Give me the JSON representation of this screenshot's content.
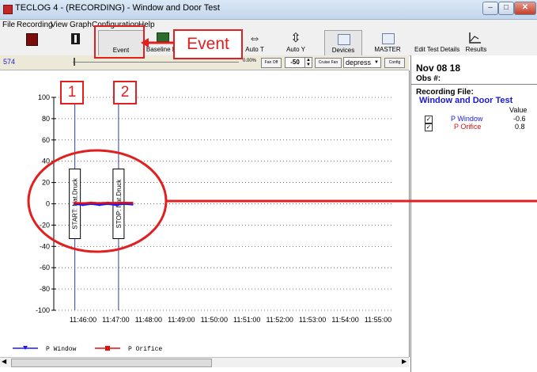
{
  "window": {
    "title": "TECLOG 4 - (RECORDING) - Window and Door Test",
    "minimize": "–",
    "maximize": "□",
    "close": "✕"
  },
  "menu": [
    "File",
    "Recording",
    "View",
    "Graph",
    "Configuration",
    "Help"
  ],
  "toolbar": {
    "buttons": [
      {
        "label": "",
        "icon": "stop-icon"
      },
      {
        "label": "",
        "icon": "pause-icon"
      },
      {
        "label": "Event",
        "icon": "event-icon"
      },
      {
        "label": "Baseline E",
        "icon": "baseline-icon"
      },
      {
        "label": "Auto T",
        "icon": "horizontal-arrows-icon"
      },
      {
        "label": "Auto Y",
        "icon": "vertical-arrows-icon"
      },
      {
        "label": "Devices",
        "icon": "devices-icon"
      },
      {
        "label": "MASTER",
        "icon": "master-icon"
      },
      {
        "label": "Edit Test Details",
        "icon": ""
      },
      {
        "label": "Results",
        "icon": "results-chart-icon"
      }
    ]
  },
  "controls": {
    "counter": "574",
    "percent": "0.00%",
    "fan_off": "Fan Off",
    "fan_value": "-50",
    "cruise_fan": "Cruise Fan",
    "mode_select": "depress",
    "config": "Config"
  },
  "chart_data": {
    "type": "line",
    "xlabel": "",
    "ylabel": "",
    "x_ticks": [
      "11:46:00",
      "11:47:00",
      "11:48:00",
      "11:49:00",
      "11:50:00",
      "11:51:00",
      "11:52:00",
      "11:53:00",
      "11:54:00",
      "11:55:00"
    ],
    "y_ticks": [
      "100",
      "80",
      "60",
      "40",
      "20",
      "0",
      "-20",
      "-40",
      "-60",
      "-80",
      "-100"
    ],
    "ylim": [
      -100,
      100
    ],
    "grid": true,
    "series": [
      {
        "name": "P Window",
        "color": "#1a1aff",
        "x": [
          "11:45:45",
          "11:46:00",
          "11:46:15",
          "11:46:30",
          "11:46:45",
          "11:47:00",
          "11:47:15",
          "11:47:30"
        ],
        "values": [
          0,
          -1,
          0,
          -1,
          0,
          -1,
          0,
          -0.6
        ]
      },
      {
        "name": "P Orifice",
        "color": "#e01010",
        "x": [
          "11:45:45",
          "11:46:00",
          "11:46:15",
          "11:46:30",
          "11:46:45",
          "11:47:00",
          "11:47:15",
          "11:47:30"
        ],
        "values": [
          0.8,
          0.5,
          1,
          0.6,
          0.9,
          0.7,
          1,
          0.8
        ]
      }
    ],
    "events": [
      {
        "label": "START: Nat.Druck",
        "x": "11:45:45"
      },
      {
        "label": "STOP: Nat.Druck",
        "x": "11:47:05"
      }
    ],
    "legend_position": "bottom-left"
  },
  "right_panel": {
    "date": "Nov 08 18",
    "obs": "Obs #:",
    "recording_file_label": "Recording File:",
    "recording_file": "Window and Door Test",
    "value_header": "Value",
    "channels": [
      {
        "name": "P Window",
        "value": "-0.6",
        "color": "#1a1aff",
        "checked": true
      },
      {
        "name": "P Orifice",
        "value": "0.8",
        "color": "#e01010",
        "checked": true
      }
    ]
  },
  "annotations": {
    "event_callout": "Event",
    "marker_1": "1",
    "marker_2": "2",
    "accent": "#e21f1f"
  }
}
